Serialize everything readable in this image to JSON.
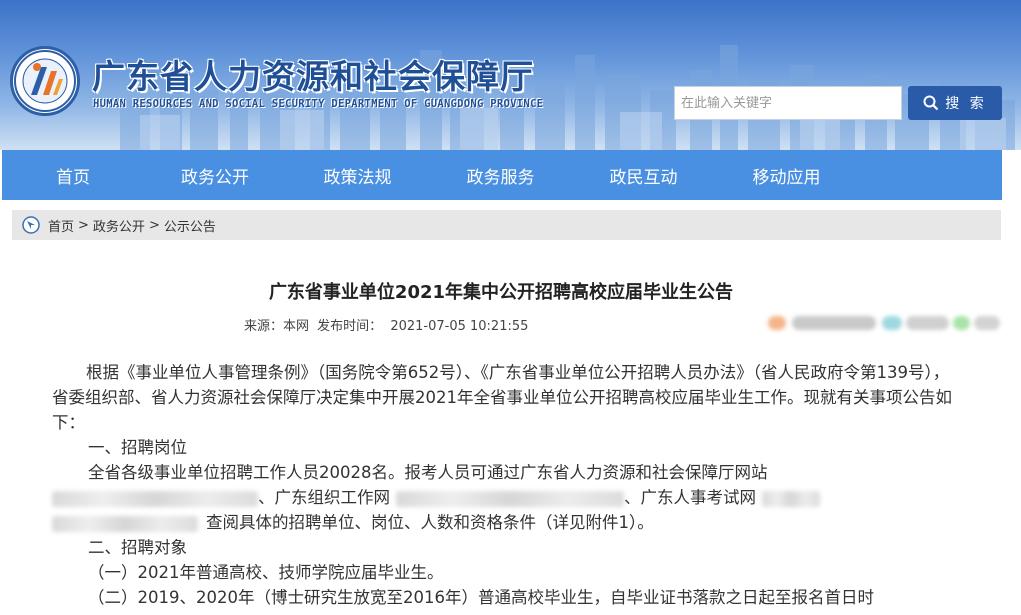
{
  "header": {
    "title_cn": "广东省人力资源和社会保障厅",
    "title_en": "HUMAN RESOURCES AND SOCIAL SECURITY DEPARTMENT OF GUANGDONG PROVINCE",
    "search_placeholder": "在此输入关键字",
    "search_label": "搜 索"
  },
  "nav": {
    "items": [
      "首页",
      "政务公开",
      "政策法规",
      "政务服务",
      "政民互动",
      "移动应用"
    ]
  },
  "breadcrumb": {
    "items": [
      "首页",
      "政务公开",
      "公示公告"
    ],
    "separator": ">"
  },
  "article": {
    "title": "广东省事业单位2021年集中公开招聘高校应届毕业生公告",
    "source_label": "来源：本网",
    "date_label": "发布时间：",
    "date": "2021-07-05 10:21:55",
    "para1": "根据《事业单位人事管理条例》（国务院令第652号）、《广东省事业单位公开招聘人员办法》（省人民政府令第139号），省委组织部、省人力资源社会保障厅决定集中开展2021年全省事业单位公开招聘高校应届毕业生工作。现就有关事项公告如下：",
    "section1": "一、招聘岗位",
    "para2_a": "全省各级事业单位招聘工作人员20028名。报考人员可通过广东省人力资源和社会保障厅网站",
    "para2_b": "、广东组织工作网",
    "para2_c": "、广东人事考试网",
    "para2_d": "查阅具体的招聘单位、岗位、人数和资格条件（详见附件1）。",
    "section2": "二、招聘对象",
    "item1": "（一）2021年普通高校、技师学院应届毕业生。",
    "item2": "（二）2019、2020年（博士研究生放宽至2016年）普通高校毕业生，自毕业证书落款之日起至报名首日时"
  },
  "colors": {
    "nav_bg": "#4a90e2",
    "brand_blue": "#1f4f96",
    "search_button": "#2a5ba8",
    "breadcrumb_bg": "#e7e7e7"
  }
}
